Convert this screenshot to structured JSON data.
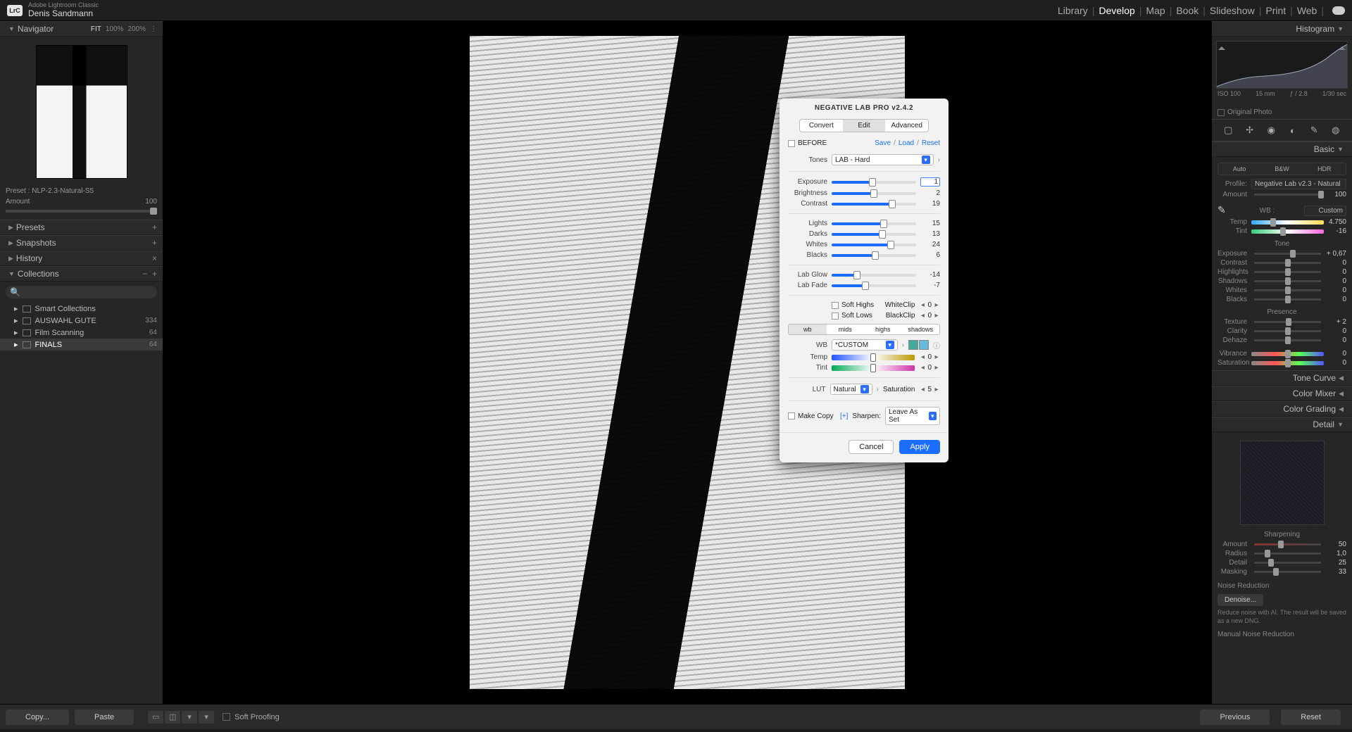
{
  "app": {
    "brand": "LrC",
    "name": "Adobe Lightroom Classic",
    "user": "Denis Sandmann"
  },
  "modules": {
    "items": [
      "Library",
      "Develop",
      "Map",
      "Book",
      "Slideshow",
      "Print",
      "Web"
    ],
    "active": "Develop"
  },
  "navigator": {
    "title": "Navigator",
    "zoom": [
      "FIT",
      "100%",
      "200%"
    ],
    "zoom_sel": "FIT",
    "preset_label": "Preset :",
    "preset_value": "NLP-2.3-Natural-S5",
    "amount_label": "Amount",
    "amount_value": "100"
  },
  "leftPanels": {
    "presets": "Presets",
    "snapshots": "Snapshots",
    "history": "History",
    "collections": "Collections"
  },
  "collections": [
    {
      "name": "Smart Collections",
      "count": ""
    },
    {
      "name": "AUSWAHL GUTE",
      "count": "334"
    },
    {
      "name": "Film Scanning",
      "count": "64"
    },
    {
      "name": "FINALS",
      "count": "64",
      "selected": true
    }
  ],
  "nlp": {
    "title": "NEGATIVE LAB PRO v2.4.2",
    "tabs": [
      "Convert",
      "Edit",
      "Advanced"
    ],
    "tab_active": "Edit",
    "before": "BEFORE",
    "links": {
      "save": "Save",
      "load": "Load",
      "reset": "Reset"
    },
    "tones_label": "Tones",
    "tones_value": "LAB - Hard",
    "sliders": {
      "exposure": {
        "label": "Exposure",
        "value": "1",
        "pct": 48
      },
      "brightness": {
        "label": "Brightness",
        "value": "2",
        "pct": 50
      },
      "contrast": {
        "label": "Contrast",
        "value": "19",
        "pct": 72
      },
      "lights": {
        "label": "Lights",
        "value": "15",
        "pct": 62
      },
      "darks": {
        "label": "Darks",
        "value": "13",
        "pct": 60
      },
      "whites": {
        "label": "Whites",
        "value": "24",
        "pct": 70
      },
      "blacks": {
        "label": "Blacks",
        "value": "6",
        "pct": 52
      },
      "labglow": {
        "label": "Lab Glow",
        "value": "-14",
        "pct": 30
      },
      "labfade": {
        "label": "Lab Fade",
        "value": "-7",
        "pct": 40
      }
    },
    "soft_highs": "Soft Highs",
    "soft_lows": "Soft Lows",
    "whiteclip": "WhiteClip",
    "whiteclip_val": "0",
    "blackclip": "BlackClip",
    "blackclip_val": "0",
    "seg": [
      "wb",
      "mids",
      "highs",
      "shadows"
    ],
    "seg_active": "wb",
    "wb_label": "WB",
    "wb_value": "*CUSTOM",
    "temp_label": "Temp",
    "temp_val": "0",
    "tint_label": "Tint",
    "tint_val": "0",
    "lut_label": "LUT",
    "lut_value": "Natural",
    "sat_label": "Saturation",
    "sat_val": "5",
    "makecopy": "Make Copy",
    "plus": "[+]",
    "sharpen_label": "Sharpen:",
    "sharpen_value": "Leave As Set",
    "cancel": "Cancel",
    "apply": "Apply"
  },
  "right": {
    "histogram": {
      "title": "Histogram",
      "iso": "ISO 100",
      "focal": "15 mm",
      "aperture": "ƒ / 2.8",
      "shutter": "1/30 sec"
    },
    "original": "Original Photo",
    "basic": {
      "title": "Basic",
      "tabs": [
        "Auto",
        "B&W",
        "HDR"
      ],
      "profile_label": "Profile:",
      "profile_value": "Negative Lab v2.3 - Natural",
      "amount_label": "Amount",
      "amount_value": "100",
      "wb_title": "WB :",
      "wb_value": "Custom",
      "temp": {
        "label": "Temp",
        "value": "4.750",
        "pct": 30
      },
      "tint": {
        "label": "Tint",
        "value": "-16",
        "pct": 44
      },
      "tone_title": "Tone",
      "exposure": {
        "label": "Exposure",
        "value": "+ 0,67",
        "pct": 58
      },
      "contrast": {
        "label": "Contrast",
        "value": "0",
        "pct": 50
      },
      "highlights": {
        "label": "Highlights",
        "value": "0",
        "pct": 50
      },
      "shadows": {
        "label": "Shadows",
        "value": "0",
        "pct": 50
      },
      "whites": {
        "label": "Whites",
        "value": "0",
        "pct": 50
      },
      "blacks": {
        "label": "Blacks",
        "value": "0",
        "pct": 50
      },
      "presence_title": "Presence",
      "texture": {
        "label": "Texture",
        "value": "+ 2",
        "pct": 52
      },
      "clarity": {
        "label": "Clarity",
        "value": "0",
        "pct": 50
      },
      "dehaze": {
        "label": "Dehaze",
        "value": "0",
        "pct": 50
      },
      "vibrance": {
        "label": "Vibrance",
        "value": "0",
        "pct": 50
      },
      "saturation": {
        "label": "Saturation",
        "value": "0",
        "pct": 50
      }
    },
    "panels": {
      "tonecurve": "Tone Curve",
      "colormixer": "Color Mixer",
      "colorgrading": "Color Grading",
      "detail": "Detail"
    },
    "detail": {
      "sharpening": "Sharpening",
      "amount": {
        "label": "Amount",
        "value": "50",
        "pct": 40
      },
      "radius": {
        "label": "Radius",
        "value": "1,0",
        "pct": 20
      },
      "detail": {
        "label": "Detail",
        "value": "25",
        "pct": 25
      },
      "masking": {
        "label": "Masking",
        "value": "33",
        "pct": 33
      },
      "noise_title": "Noise Reduction",
      "denoise": "Denoise...",
      "note": "Reduce noise with AI. The result will be saved as a new DNG.",
      "manual": "Manual Noise Reduction"
    }
  },
  "bottom": {
    "copy": "Copy...",
    "paste": "Paste",
    "softproof": "Soft Proofing",
    "previous": "Previous",
    "reset": "Reset"
  }
}
